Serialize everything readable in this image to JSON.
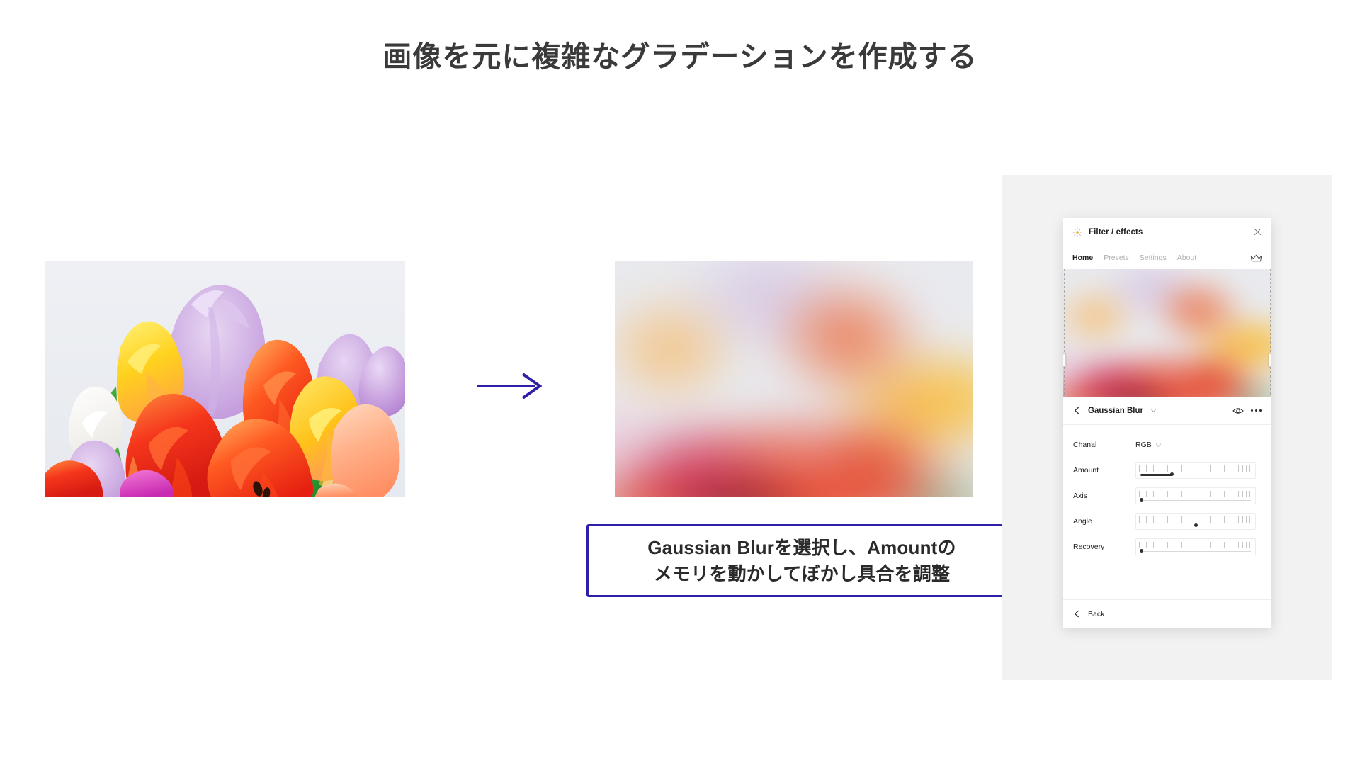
{
  "page": {
    "title": "画像を元に複雑なグラデーションを作成する",
    "background_color": "#ffffff",
    "accent_color": "#2e1fa8",
    "canvas_color": "#f2f2f2"
  },
  "before_image": {
    "name": "tulip-bouquet-photo",
    "alt": "色とりどりのチューリップの花束"
  },
  "transform_arrow": {
    "name": "right-arrow",
    "color": "#2e1fa8"
  },
  "after_image": {
    "name": "blurred-gradient-result",
    "alt": "ガウスぼかしを適用したグラデーション"
  },
  "callout": {
    "line1": "Gaussian Blurを選択し、Amountの",
    "line2": "メモリを動かしてぼかし具合を調整",
    "border_color": "#2e1fa8"
  },
  "panel": {
    "header": {
      "icon": "sparkle-icon",
      "title": "Filter / effects",
      "close_icon": "close-icon"
    },
    "tabs": [
      {
        "label": "Home",
        "active": true
      },
      {
        "label": "Presets",
        "active": false
      },
      {
        "label": "Settings",
        "active": false
      },
      {
        "label": "About",
        "active": false
      }
    ],
    "tabs_right_icon": "crown-icon",
    "preview": {
      "name": "effect-preview",
      "handles": [
        "left-resize-handle",
        "right-resize-handle"
      ]
    },
    "effect": {
      "back_icon": "chevron-left-icon",
      "name": "Gaussian Blur",
      "dropdown_icon": "chevron-down-icon",
      "visibility_icon": "eye-icon",
      "more_icon": "more-options-icon"
    },
    "params": [
      {
        "label": "Chanal",
        "type": "select",
        "value": "RGB",
        "fill_pct": 0,
        "knob_pct": 0
      },
      {
        "label": "Amount",
        "type": "slider",
        "value": "",
        "fill_pct": 30,
        "knob_pct": 30
      },
      {
        "label": "Axis",
        "type": "slider",
        "value": "",
        "fill_pct": 0,
        "knob_pct": 1
      },
      {
        "label": "Angle",
        "type": "slider",
        "value": "",
        "fill_pct": 0,
        "knob_pct": 50
      },
      {
        "label": "Recovery",
        "type": "slider",
        "value": "",
        "fill_pct": 0,
        "knob_pct": 1
      }
    ],
    "footer": {
      "back_icon": "chevron-left-icon",
      "back_label": "Back"
    }
  }
}
